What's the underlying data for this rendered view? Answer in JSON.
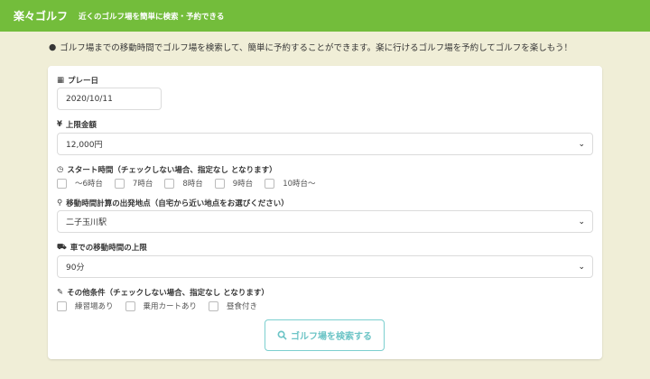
{
  "header": {
    "brand": "楽々ゴルフ",
    "tagline": "近くのゴルフ場を簡単に検索・予約できる"
  },
  "intro": "ゴルフ場までの移動時間でゴルフ場を検索して、簡単に予約することができます。楽に行けるゴルフ場を予約してゴルフを楽しもう！",
  "form": {
    "play_date": {
      "label": "プレー日",
      "value": "2020/10/11"
    },
    "budget": {
      "label": "上限金額",
      "value": "12,000円"
    },
    "start_time": {
      "label": "スタート時間（チェックしない場合、指定なし となります）",
      "options": [
        "〜6時台",
        "7時台",
        "8時台",
        "9時台",
        "10時台〜"
      ]
    },
    "departure": {
      "label": "移動時間計算の出発地点（自宅から近い地点をお選びください）",
      "value": "二子玉川駅"
    },
    "drive_time": {
      "label": "車での移動時間の上限",
      "value": "90分"
    },
    "other": {
      "label": "その他条件（チェックしない場合、指定なし となります）",
      "options": [
        "練習場あり",
        "乗用カートあり",
        "昼食付き"
      ]
    },
    "search_button": "ゴルフ場を検索する"
  }
}
